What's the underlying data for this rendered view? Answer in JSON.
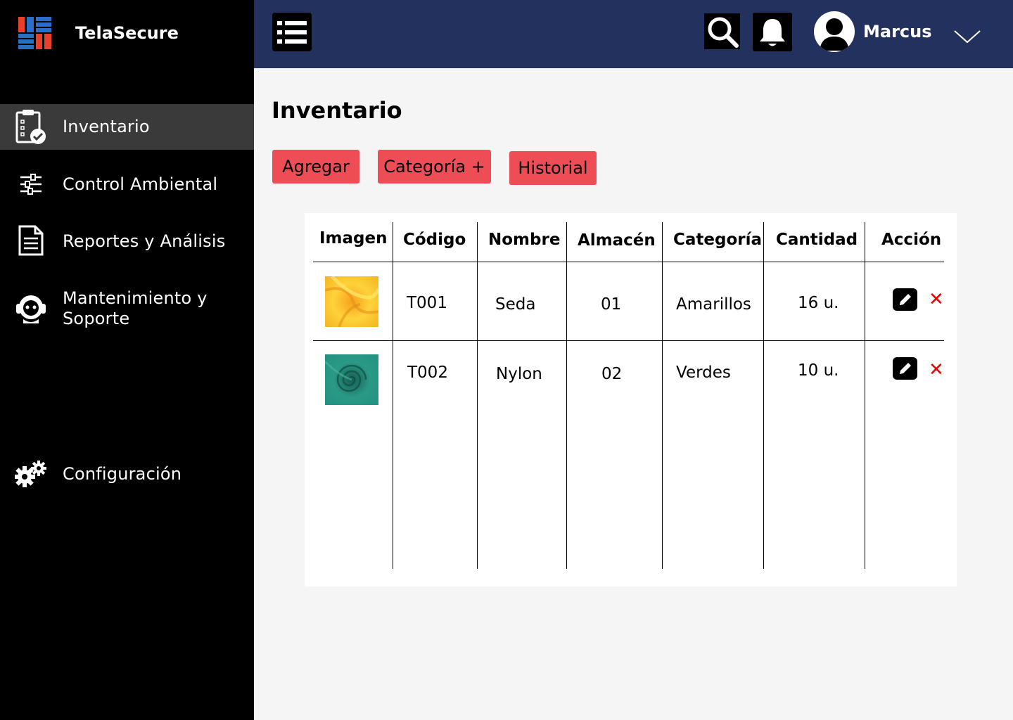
{
  "brand": {
    "name": "TelaSecure"
  },
  "sidebar": {
    "items": [
      {
        "label": "Inventario",
        "icon": "clipboard-check-icon",
        "active": true
      },
      {
        "label": "Control Ambiental",
        "icon": "sliders-icon"
      },
      {
        "label": "Reportes y Análisis",
        "icon": "document-icon"
      },
      {
        "label_line1": "Mantenimiento y",
        "label_line2": "Soporte",
        "icon": "support-agent-icon"
      },
      {
        "label": "Configuración",
        "icon": "gears-icon"
      }
    ]
  },
  "header": {
    "user_name": "Marcus",
    "icons": [
      "menu-list-icon",
      "search-icon",
      "bell-icon",
      "user-avatar-icon",
      "chevron-down-icon"
    ]
  },
  "main": {
    "title": "Inventario",
    "buttons": {
      "add": "Agregar",
      "category": "Categoría +",
      "history": "Historial"
    },
    "table": {
      "headers": [
        "Imagen",
        "Código",
        "Nombre",
        "Almacén",
        "Categoría",
        "Cantidad",
        "Acción"
      ],
      "rows": [
        {
          "image": "yellow-silk-fabric",
          "code": "T001",
          "name": "Seda",
          "warehouse": "01",
          "category": "Amarillos",
          "quantity": "16 u."
        },
        {
          "image": "green-nylon-fabric",
          "code": "T002",
          "name": "Nylon",
          "warehouse": "02",
          "category": "Verdes",
          "quantity": "10 u."
        }
      ],
      "delete_symbol": "✕"
    }
  },
  "colors": {
    "sidebar": "#000000",
    "topbar": "#22315d",
    "accent": "#ef4d55",
    "active_item": "#3a3a3a",
    "delete": "#e00000"
  }
}
